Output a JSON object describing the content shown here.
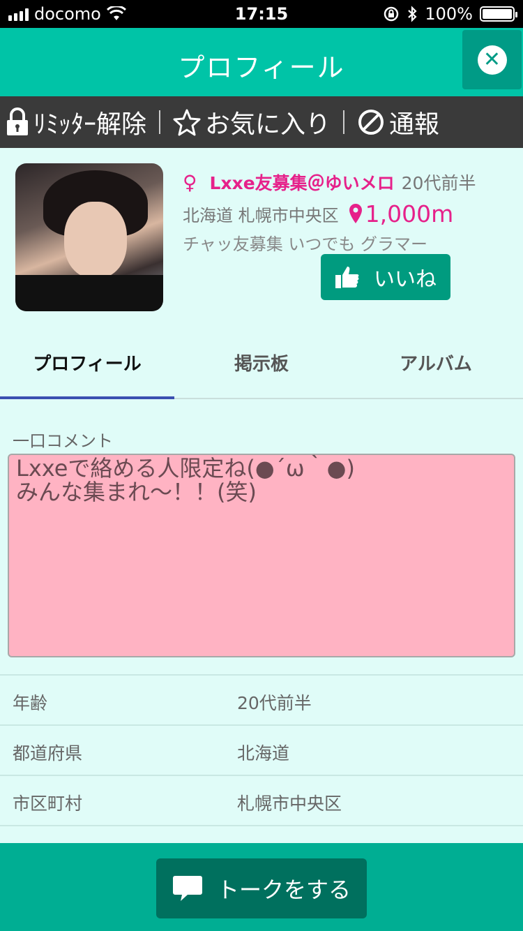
{
  "status_bar": {
    "carrier": "docomo",
    "time": "17:15",
    "battery": "100%"
  },
  "header": {
    "title": "プロフィール"
  },
  "actions": {
    "limiter": "ﾘﾐｯﾀｰ解除",
    "favorite": "お気に入り",
    "report": "通報"
  },
  "profile": {
    "name": "Lxxe友募集＠ゆいメロ",
    "age": "20代前半",
    "location": "北海道 札幌市中央区",
    "distance": "1,000m",
    "tags": "チャッ友募集  いつでも  グラマー",
    "like_label": "いいね"
  },
  "tabs": [
    {
      "label": "プロフィール",
      "active": true
    },
    {
      "label": "掲示板",
      "active": false
    },
    {
      "label": "アルバム",
      "active": false
    }
  ],
  "comment": {
    "label": "一口コメント",
    "lines": [
      "Lxxeで絡める人限定ね(●´ω｀●)",
      "みんな集まれ〜！！(笑)"
    ]
  },
  "details": [
    {
      "key": "年齢",
      "value": "20代前半"
    },
    {
      "key": "都道府県",
      "value": "北海道"
    },
    {
      "key": "市区町村",
      "value": "札幌市中央区"
    }
  ],
  "footer": {
    "talk_label": "トークをする"
  },
  "colors": {
    "accent": "#00c4a7",
    "pink": "#e6218a",
    "comment_bg": "#ffb3c3",
    "dark_green": "#009b7f"
  }
}
